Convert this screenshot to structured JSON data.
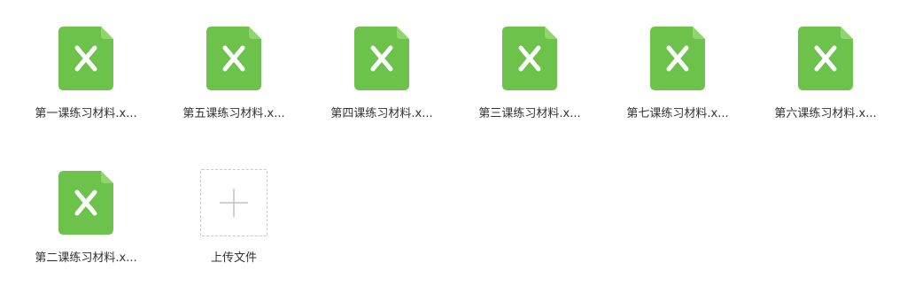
{
  "files": [
    {
      "name": "第一课练习材料.x..."
    },
    {
      "name": "第五课练习材料.x..."
    },
    {
      "name": "第四课练习材料.x..."
    },
    {
      "name": "第三课练习材料.x..."
    },
    {
      "name": "第七课练习材料.x..."
    },
    {
      "name": "第六课练习材料.x..."
    },
    {
      "name": "第二课练习材料.x..."
    }
  ],
  "upload": {
    "label": "上传文件",
    "icon": "plus-icon"
  },
  "file_icon": "excel-file-icon",
  "colors": {
    "icon_green": "#6cc24a",
    "icon_fold": "#8fd66c",
    "text": "#333333",
    "upload_border": "#c9c9c9",
    "plus": "#c2c2c2"
  }
}
